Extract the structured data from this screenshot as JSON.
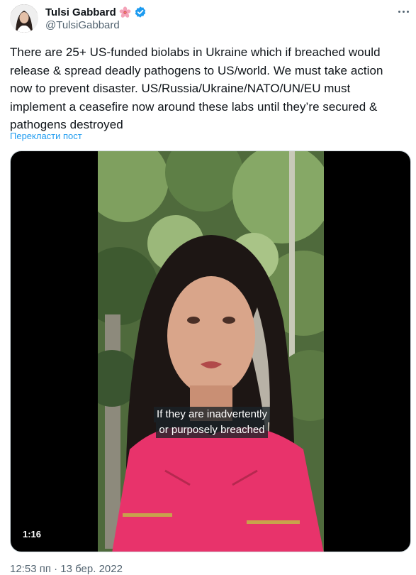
{
  "author": {
    "display_name": "Tulsi Gabbard",
    "handle": "@TulsiGabbard",
    "emoji_icon": "hibiscus-flower-icon",
    "verified_icon": "verified-badge-icon",
    "verified_color": "#1d9bf0"
  },
  "tweet": {
    "text": "There are 25+ US-funded biolabs in Ukraine which if breached would release & spread deadly pathogens to US/world. We must take action now to prevent disaster. US/Russia/Ukraine/NATO/UN/EU must implement a ceasefire now around these labs until they’re secured & pathogens destroyed",
    "translate_label": "Перекласти пост"
  },
  "video": {
    "caption_lines": [
      "If they are inadvertently",
      "or purposely breached"
    ],
    "duration": "1:16"
  },
  "meta": {
    "timestamp": "12:53 пп · 13 бер. 2022"
  },
  "colors": {
    "link": "#1d9bf0",
    "secondary_text": "#536471",
    "primary_text": "#0f1419"
  }
}
